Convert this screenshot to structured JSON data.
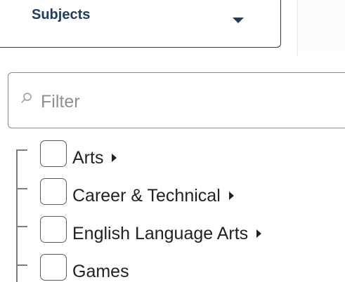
{
  "dropdown": {
    "label": "Subjects",
    "caret_icon": "caret-down-icon"
  },
  "filter": {
    "placeholder": "Filter",
    "value": "",
    "icon": "search-icon"
  },
  "tree": {
    "items": [
      {
        "label": "Arts",
        "checked": false,
        "has_children": true
      },
      {
        "label": "Career & Technical",
        "checked": false,
        "has_children": true
      },
      {
        "label": "English Language Arts",
        "checked": false,
        "has_children": true
      },
      {
        "label": "Games",
        "checked": false,
        "has_children": false
      }
    ]
  },
  "colors": {
    "accent": "#1f3b63",
    "border": "#8a8a8a",
    "text": "#222222"
  }
}
